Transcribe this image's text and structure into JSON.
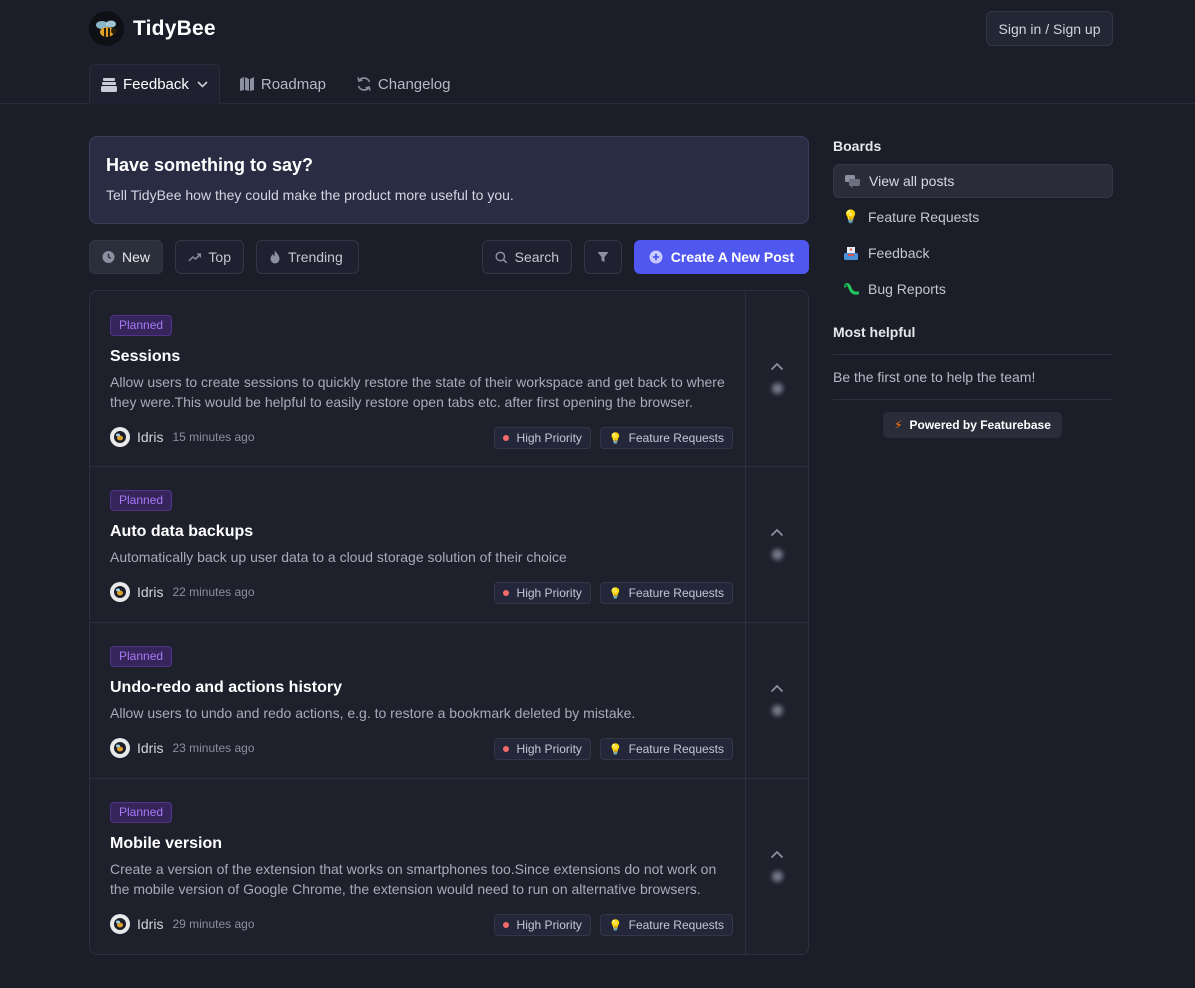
{
  "header": {
    "brand": "TidyBee",
    "signin_label": "Sign in / Sign up",
    "tabs": [
      {
        "label": "Feedback",
        "icon": "inbox-icon",
        "active": true
      },
      {
        "label": "Roadmap",
        "icon": "roadmap-icon",
        "active": false
      },
      {
        "label": "Changelog",
        "icon": "refresh-icon",
        "active": false
      }
    ]
  },
  "banner": {
    "title": "Have something to say?",
    "subtitle": "Tell TidyBee how they could make the product more useful to you."
  },
  "toolbar": {
    "sort_new": "New",
    "sort_top": "Top",
    "sort_trending": "Trending",
    "search_label": "Search",
    "create_label": "Create A New Post",
    "accent": "#5057ef"
  },
  "posts": [
    {
      "status": "Planned",
      "title": "Sessions",
      "description": "Allow users to create sessions to quickly restore the state of their workspace and get back to where they were.This would be helpful to easily restore open tabs etc. after first opening the browser.",
      "author": "Idris",
      "time": "15 minutes ago",
      "priority": "High Priority",
      "board": "Feature Requests"
    },
    {
      "status": "Planned",
      "title": "Auto data backups",
      "description": "Automatically back up user data to a cloud storage solution of their choice",
      "author": "Idris",
      "time": "22 minutes ago",
      "priority": "High Priority",
      "board": "Feature Requests"
    },
    {
      "status": "Planned",
      "title": "Undo-redo and actions history",
      "description": "Allow users to undo and redo actions, e.g. to restore a bookmark deleted by mistake.",
      "author": "Idris",
      "time": "23 minutes ago",
      "priority": "High Priority",
      "board": "Feature Requests"
    },
    {
      "status": "Planned",
      "title": "Mobile version",
      "description": "Create a version of the extension that works on smartphones too.Since extensions do not work on the mobile version of Google Chrome, the extension would need to run on alternative browsers.",
      "author": "Idris",
      "time": "29 minutes ago",
      "priority": "High Priority",
      "board": "Feature Requests"
    }
  ],
  "sidebar": {
    "boards_heading": "Boards",
    "boards": [
      {
        "label": "View all posts",
        "icon": "chat-bubbles-icon",
        "active": true
      },
      {
        "label": "Feature Requests",
        "icon": "lightbulb-icon",
        "active": false
      },
      {
        "label": "Feedback",
        "icon": "inbox-tray-icon",
        "active": false
      },
      {
        "label": "Bug Reports",
        "icon": "bug-icon",
        "active": false
      }
    ],
    "helpful_heading": "Most helpful",
    "helpful_empty": "Be the first one to help the team!",
    "powered_label": "Powered by Featurebase"
  }
}
